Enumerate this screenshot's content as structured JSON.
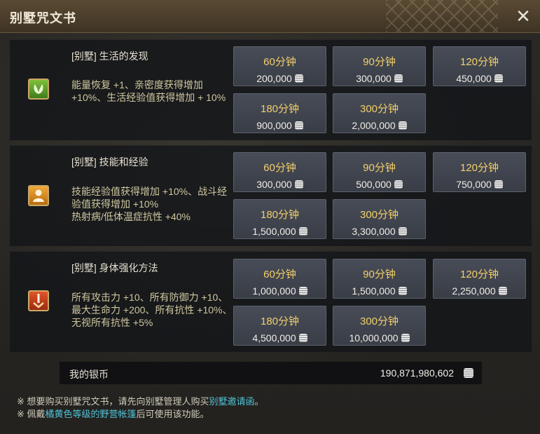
{
  "window": {
    "title": "别墅咒文书"
  },
  "sections": [
    {
      "name": "[别墅] 生活的发现",
      "description": "能量恢复 +1、亲密度获得增加 +10%、生活经验值获得增加 + 10%",
      "icon": "leaf-icon",
      "options": [
        {
          "duration": "60分钟",
          "price": "200,000"
        },
        {
          "duration": "90分钟",
          "price": "300,000"
        },
        {
          "duration": "120分钟",
          "price": "450,000"
        },
        {
          "duration": "180分钟",
          "price": "900,000"
        },
        {
          "duration": "300分钟",
          "price": "2,000,000"
        }
      ]
    },
    {
      "name": "[别墅] 技能和经验",
      "description": "技能经验值获得增加 +10%、战斗经验值获得增加 +10%\n热射病/低体温症抗性 +40%",
      "icon": "person-icon",
      "options": [
        {
          "duration": "60分钟",
          "price": "300,000"
        },
        {
          "duration": "90分钟",
          "price": "500,000"
        },
        {
          "duration": "120分钟",
          "price": "750,000"
        },
        {
          "duration": "180分钟",
          "price": "1,500,000"
        },
        {
          "duration": "300分钟",
          "price": "3,300,000"
        }
      ]
    },
    {
      "name": "[别墅] 身体强化方法",
      "description": "所有攻击力 +10、所有防御力 +10、最大生命力 +200、所有抗性 +10%、无视所有抗性 +5%",
      "icon": "sword-icon",
      "options": [
        {
          "duration": "60分钟",
          "price": "1,000,000"
        },
        {
          "duration": "90分钟",
          "price": "1,500,000"
        },
        {
          "duration": "120分钟",
          "price": "2,250,000"
        },
        {
          "duration": "180分钟",
          "price": "4,500,000"
        },
        {
          "duration": "300分钟",
          "price": "10,000,000"
        }
      ]
    }
  ],
  "silver": {
    "label": "我的银币",
    "value": "190,871,980,602"
  },
  "notes": {
    "line1_prefix": "※ 想要购买别墅咒文书，请先向别墅管理人购买",
    "line1_highlight": "别墅邀请函",
    "line1_suffix": "。",
    "line2_prefix": "※ 佩戴",
    "line2_highlight": "橘黄色等级的野营帐篷",
    "line2_suffix": "后可使用该功能。"
  },
  "colors": {
    "accent_gold": "#f3cf6b",
    "highlight_cyan": "#4ec3d9"
  }
}
